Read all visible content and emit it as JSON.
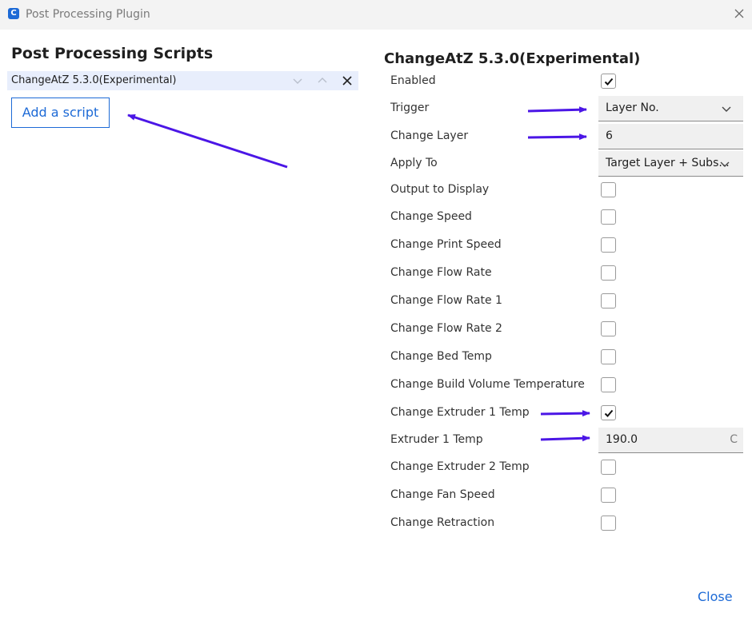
{
  "window": {
    "title": "Post Processing Plugin",
    "app_icon": "C"
  },
  "left": {
    "title": "Post Processing Scripts",
    "scripts": [
      {
        "label": "ChangeAtZ 5.3.0(Experimental)"
      }
    ],
    "add_button": "Add a script"
  },
  "right": {
    "title": "ChangeAtZ 5.3.0(Experimental)",
    "settings": {
      "enabled": {
        "label": "Enabled",
        "checked": true
      },
      "trigger": {
        "label": "Trigger",
        "value": "Layer No."
      },
      "change_layer": {
        "label": "Change Layer",
        "value": "6"
      },
      "apply_to": {
        "label": "Apply To",
        "value": "Target Layer + Subs..."
      },
      "output_to_display": {
        "label": "Output to Display",
        "checked": false
      },
      "change_speed": {
        "label": "Change Speed",
        "checked": false
      },
      "change_print_speed": {
        "label": "Change Print Speed",
        "checked": false
      },
      "change_flow_rate": {
        "label": "Change Flow Rate",
        "checked": false
      },
      "change_flow_rate_1": {
        "label": "Change Flow Rate 1",
        "checked": false
      },
      "change_flow_rate_2": {
        "label": "Change Flow Rate 2",
        "checked": false
      },
      "change_bed_temp": {
        "label": "Change Bed Temp",
        "checked": false
      },
      "change_build_volume_temp": {
        "label": "Change Build Volume Temperature",
        "checked": false
      },
      "change_extruder_1_temp": {
        "label": "Change Extruder 1 Temp",
        "checked": true
      },
      "extruder_1_temp": {
        "label": "Extruder 1 Temp",
        "value": "190.0",
        "unit": "C"
      },
      "change_extruder_2_temp": {
        "label": "Change Extruder 2 Temp",
        "checked": false
      },
      "change_fan_speed": {
        "label": "Change Fan Speed",
        "checked": false
      },
      "change_retraction": {
        "label": "Change Retraction",
        "checked": false
      }
    }
  },
  "footer": {
    "close": "Close"
  },
  "colors": {
    "accent": "#1d6ad6",
    "annotation_arrow": "#4b16e6",
    "selected_row": "#e8eefc"
  }
}
